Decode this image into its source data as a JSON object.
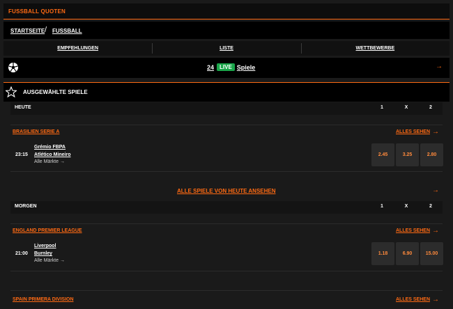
{
  "title": "FUSSBALL QUOTEN",
  "breadcrumb": {
    "home": "STARTSEITE",
    "separator": "/",
    "current": "FUSSBALL"
  },
  "tabs": [
    {
      "label": "EMPFEHLUNGEN"
    },
    {
      "label": "LISTE"
    },
    {
      "label": "WETTBEWERBE"
    }
  ],
  "live": {
    "count": "24",
    "badge": "LIVE",
    "label": "Spiele"
  },
  "section": {
    "title": "AUSGEWÄHLTE SPIELE"
  },
  "days": [
    {
      "label": "HEUTE",
      "cols": [
        "1",
        "X",
        "2"
      ]
    },
    {
      "label": "MORGEN",
      "cols": [
        "1",
        "X",
        "2"
      ]
    }
  ],
  "leagues": {
    "brasil": "BRASILIEN SERIE A",
    "england": "ENGLAND PREMIER LEAGUE",
    "spain": "SPAIN PRIMERA DIVISION"
  },
  "all_see_label": "ALLES SEHEN",
  "matches": [
    {
      "time": "23:15",
      "home": "Grémio FBPA",
      "away": "Atlético Mineiro",
      "markets": "Alle Märkte",
      "odds": [
        "2.45",
        "3.25",
        "2.80"
      ]
    },
    {
      "time": "21:00",
      "home": "Liverpool",
      "away": "Burnley",
      "markets": "Alle Märkte",
      "odds": [
        "1.18",
        "6.90",
        "15.00"
      ]
    }
  ],
  "see_all_today": "ALLE SPIELE VON HEUTE ANSEHEN",
  "colors": {
    "accent": "#ff6a13",
    "live": "#1aa64a",
    "background": "#1a1a1a"
  },
  "icons": {
    "ball": "football-icon",
    "star": "star-outline-icon",
    "arrow": "arrow-right-icon"
  }
}
